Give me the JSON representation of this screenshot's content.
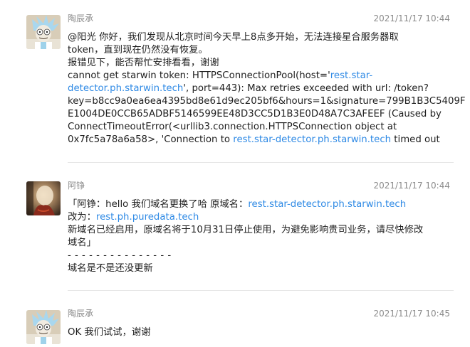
{
  "messages": [
    {
      "sender": "陶辰承",
      "time": "2021/11/17 10:44",
      "lines": [
        "@阳光 你好，我们发现从北京时间今天早上8点多开始，无法连接星合服务器取",
        "token，直到现在仍然没有恢复。",
        "报错见下，能否帮忙安排看看，谢谢"
      ],
      "error_prefix": "cannot get starwin token: HTTPSConnectionPool(host='",
      "error_link1_part1": "rest.star-",
      "error_link1_part2": "detector.ph.starwin.tech",
      "error_mid": "', port=443): Max retries exceeded with url: /token?",
      "error_key_line": "key=b8cc9a0ea6ea4395bd8e61d9ec205bf6&hours=1&signature=799B1B3C5409F",
      "error_sig_line": "E1004DE0CCB65ADBF5146599EE48D3CC5D1B3E0D48A7C3AFEEF (Caused by",
      "error_conn_line": "ConnectTimeoutError(<urllib3.connection.HTTPSConnection object at",
      "error_last_prefix": "0x7fc5a78a6a58>, 'Connection to ",
      "error_link2": "rest.star-detector.ph.starwin.tech",
      "error_last_suffix": " timed out"
    },
    {
      "sender": "阿铮",
      "time": "2021/11/17 10:44",
      "quote_prefix": "「阿铮：hello 我们域名更换了哈 原域名：",
      "quote_link_old": "rest.star-detector.ph.starwin.tech",
      "change_prefix": "改为：",
      "quote_link_new": "rest.ph.puredata.tech",
      "notice_line1": "新域名已经启用，原域名将于10月31日停止使用，为避免影响贵司业务，请尽快修改",
      "notice_line2": "域名」",
      "separator": "- - - - - - - - - - - - - - -",
      "question": "域名是不是还没更新"
    },
    {
      "sender": "陶辰承",
      "time": "2021/11/17 10:45",
      "text": "OK 我们试试，谢谢"
    }
  ],
  "colors": {
    "link": "#2f8ae5",
    "meta": "#8c8c8c",
    "divider": "#e6e6e6",
    "text": "#1f1f1f"
  },
  "icons": {
    "avatar_1": "cartoon-scientist-avatar",
    "avatar_2": "photo-avatar",
    "avatar_3": "cartoon-scientist-avatar"
  }
}
